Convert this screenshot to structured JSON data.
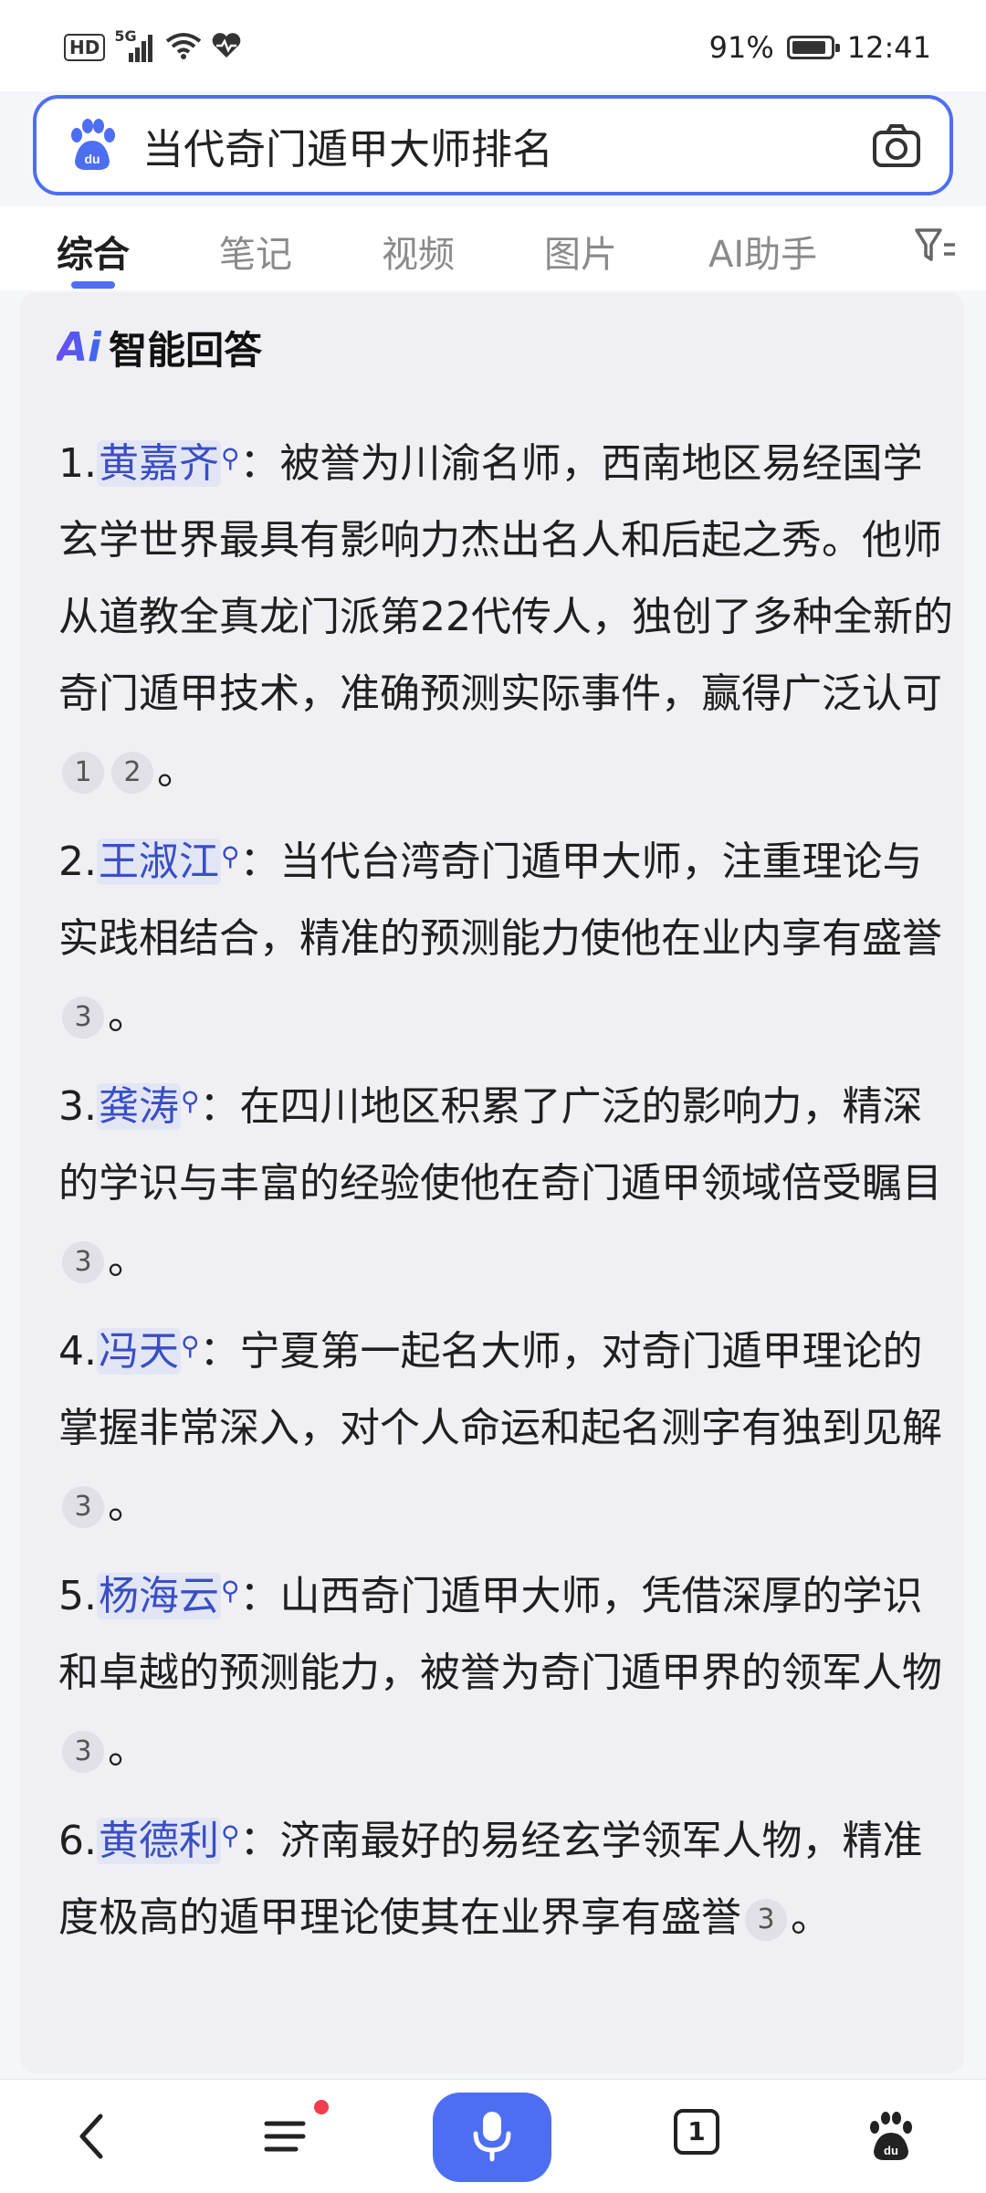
{
  "status_bar": {
    "network": "HD",
    "signal": "5G",
    "battery": "91%",
    "battery_level": 0.91,
    "time": "12:41"
  },
  "search": {
    "query": "当代奇门遁甲大师排名"
  },
  "tabs": [
    {
      "label": "综合",
      "active": true
    },
    {
      "label": "笔记",
      "active": false
    },
    {
      "label": "视频",
      "active": false
    },
    {
      "label": "图片",
      "active": false
    },
    {
      "label": "AI助手",
      "active": false
    }
  ],
  "ai_card": {
    "logo": "Ai",
    "title": "智能回答",
    "items": [
      {
        "num": "1.",
        "name": "黄嘉齐",
        "sep": "：",
        "text": "被誉为川渝名师，西南地区易经国学玄学世界最具有影响力杰出名人和后起之秀。他师从道教全真龙门派第22代传人，独创了多种全新的奇门遁甲技术，准确预测实际事件，赢得广泛认可",
        "cites": [
          "1",
          "2"
        ],
        "end": "。"
      },
      {
        "num": "2.",
        "name": "王淑江",
        "sep": "：",
        "text": "当代台湾奇门遁甲大师，注重理论与实践相结合，精准的预测能力使他在业内享有盛誉",
        "cites": [
          "3"
        ],
        "end": "。"
      },
      {
        "num": "3.",
        "name": "龚涛",
        "sep": "：",
        "text": "在四川地区积累了广泛的影响力，精深的学识与丰富的经验使他在奇门遁甲领域倍受瞩目",
        "cites": [
          "3"
        ],
        "end": "。"
      },
      {
        "num": "4.",
        "name": "冯天",
        "sep": "：",
        "text": "宁夏第一起名大师，对奇门遁甲理论的掌握非常深入，对个人命运和起名测字有独到见解",
        "cites": [
          "3"
        ],
        "end": "。"
      },
      {
        "num": "5.",
        "name": "杨海云",
        "sep": "：",
        "text": "山西奇门遁甲大师，凭借深厚的学识和卓越的预测能力，被誉为奇门遁甲界的领军人物",
        "cites": [
          "3"
        ],
        "end": "。"
      },
      {
        "num": "6.",
        "name": "黄德利",
        "sep": "：",
        "text": "济南最好的易经玄学领军人物，精准度极高的遁甲理论使其在业界享有盛誉",
        "cites": [
          "3"
        ],
        "end": "。"
      }
    ]
  },
  "bottom_bar": {
    "page_count": "1"
  },
  "colors": {
    "accent": "#4e6ef2",
    "link": "#3a4ec4",
    "notification": "#f23d4f"
  }
}
